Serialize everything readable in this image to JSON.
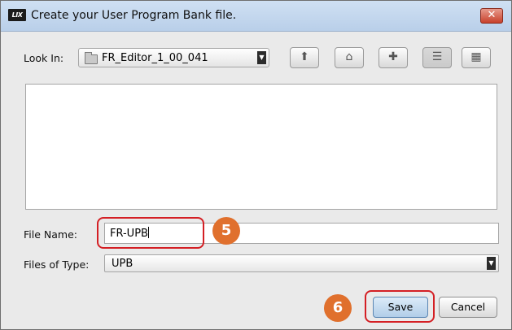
{
  "titlebar": {
    "logo_text": "LIX",
    "title": "Create your User Program Bank file.",
    "close_glyph": "✕"
  },
  "look_in": {
    "label": "Look In:",
    "value": "FR_Editor_1_00_041",
    "arrow": "▼"
  },
  "toolbar": {
    "buttons": [
      {
        "name": "up-one-level",
        "glyph": "⬆"
      },
      {
        "name": "home",
        "glyph": "⌂"
      },
      {
        "name": "new-folder",
        "glyph": "✚"
      },
      {
        "name": "list-view",
        "glyph": "☰"
      },
      {
        "name": "details-view",
        "glyph": "▦"
      }
    ]
  },
  "file_name": {
    "label": "File Name:",
    "value": "FR-UPB"
  },
  "file_type": {
    "label": "Files of Type:",
    "value": "UPB",
    "arrow": "▼"
  },
  "actions": {
    "save_label": "Save",
    "cancel_label": "Cancel"
  },
  "annotations": {
    "step5": "5",
    "step6": "6",
    "badge_color": "#e0702d",
    "highlight_color": "#d41f24"
  }
}
